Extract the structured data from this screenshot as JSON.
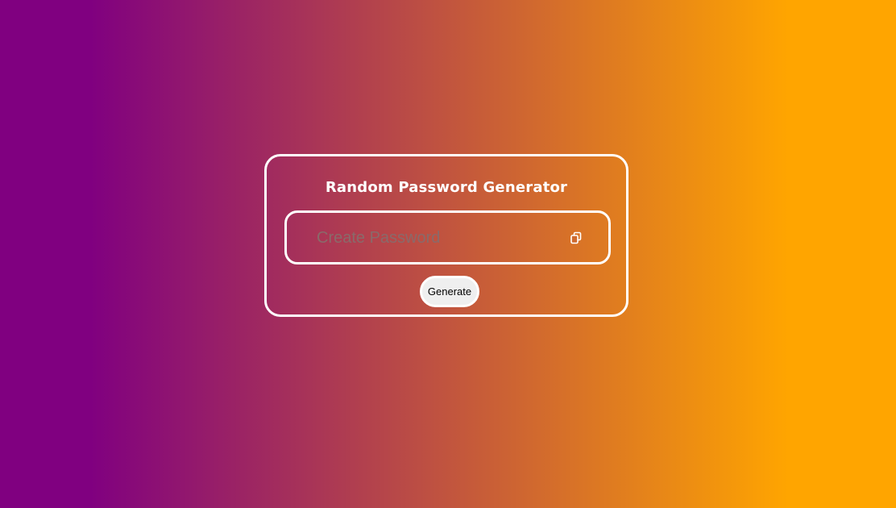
{
  "app": {
    "title": "Random Password Generator"
  },
  "password": {
    "value": "",
    "placeholder": "Create Password"
  },
  "copy_button": {
    "icon": "copy-icon"
  },
  "generate_button": {
    "label": "Generate"
  },
  "colors": {
    "gradient_start": "#800080",
    "gradient_end": "#ffa500",
    "border": "#ffffff",
    "button_bg": "#efefef"
  }
}
